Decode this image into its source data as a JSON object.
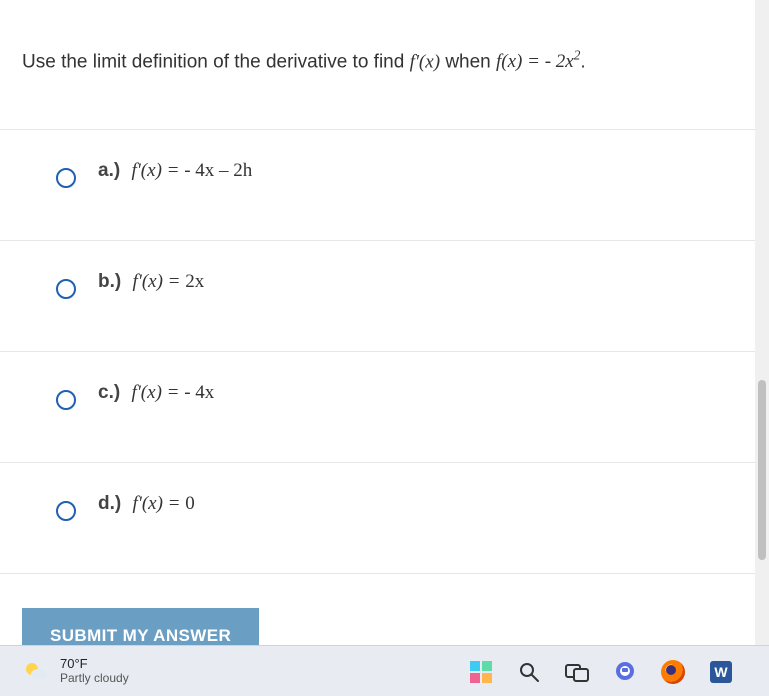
{
  "question": {
    "prefix": "Use the limit definition of the derivative to find ",
    "fprime": "f'(x)",
    "mid": " when ",
    "fx": "f(x) = - 2x",
    "exp": "2",
    "suffix": "."
  },
  "options": [
    {
      "label": "a.)",
      "lhs": "f'(x) = ",
      "rhs": "- 4x – 2h"
    },
    {
      "label": "b.)",
      "lhs": "f'(x) = ",
      "rhs": "2x"
    },
    {
      "label": "c.)",
      "lhs": "f'(x) = ",
      "rhs": "- 4x"
    },
    {
      "label": "d.)",
      "lhs": "f'(x) = ",
      "rhs": "0"
    }
  ],
  "submit_label": "SUBMIT MY ANSWER",
  "taskbar": {
    "weather": {
      "temp": "70°F",
      "desc": "Partly cloudy"
    },
    "word_letter": "W"
  }
}
